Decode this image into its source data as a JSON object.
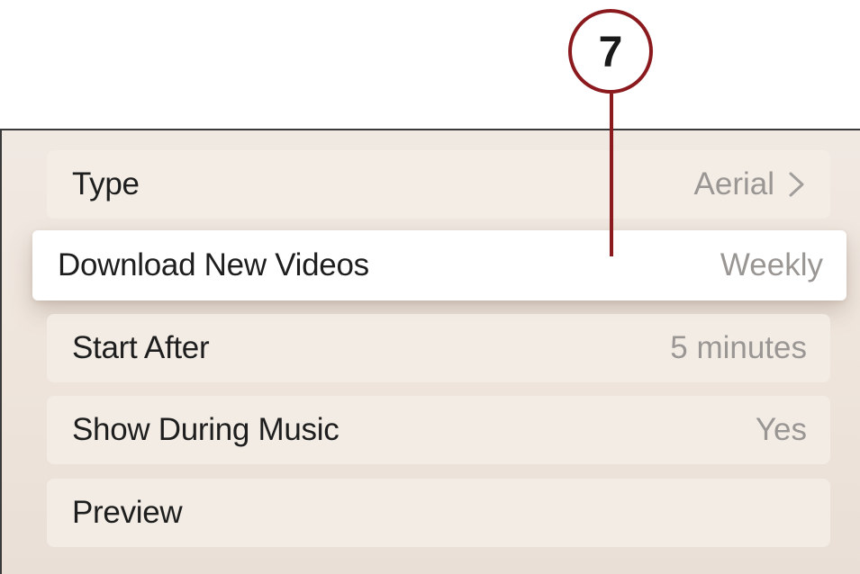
{
  "callout": {
    "number": "7"
  },
  "settings": {
    "rows": [
      {
        "label": "Type",
        "value": "Aerial",
        "has_chevron": true
      },
      {
        "label": "Download New Videos",
        "value": "Weekly",
        "focused": true
      },
      {
        "label": "Start After",
        "value": "5 minutes"
      },
      {
        "label": "Show During Music",
        "value": "Yes"
      },
      {
        "label": "Preview",
        "value": ""
      }
    ]
  },
  "colors": {
    "callout_red": "#8b1a1f",
    "value_gray": "#9a9694",
    "label_dark": "#1e1e1e",
    "background": "#efe6de"
  },
  "icons": {
    "type_row_chevron": "chevron-right-icon"
  }
}
